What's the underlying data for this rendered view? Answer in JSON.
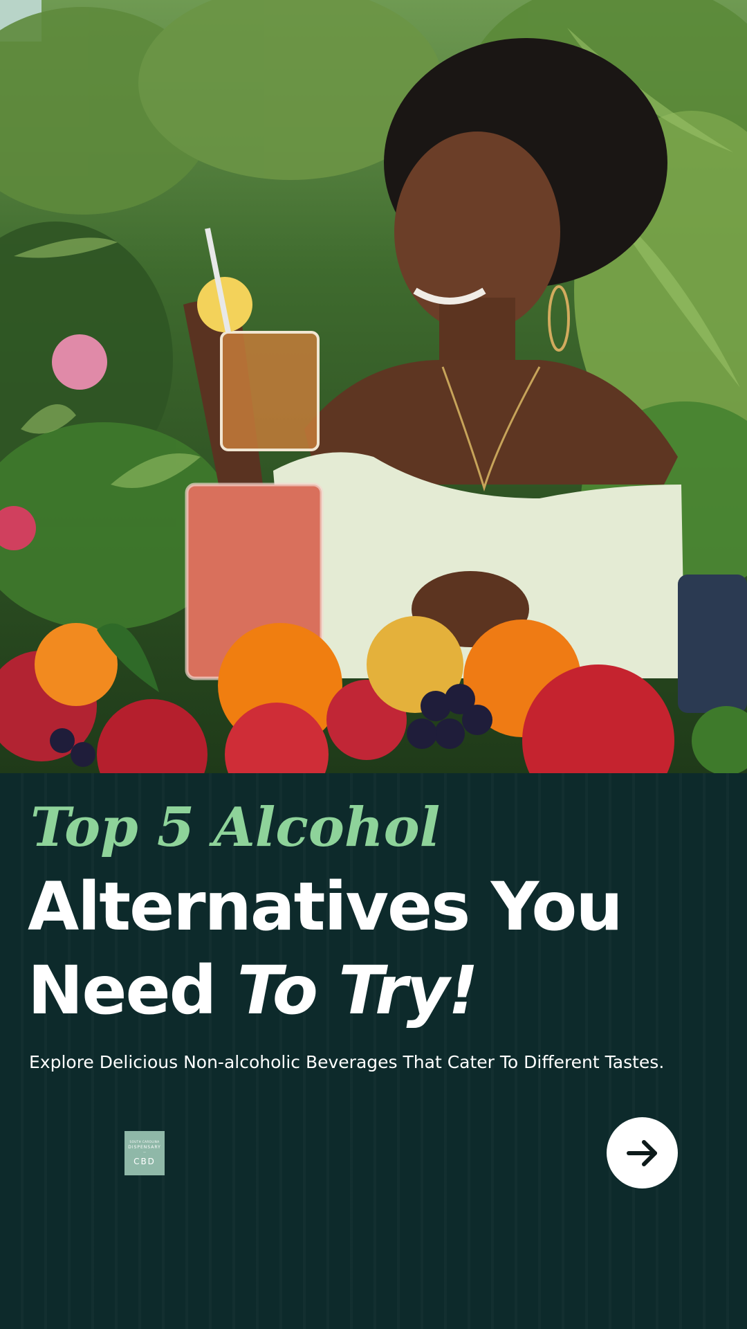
{
  "hero": {
    "icon": "photo-woman-with-drink"
  },
  "headline": {
    "line1": "Top 5 Alcohol",
    "line2": "Alternatives You",
    "line3_plain": "Need ",
    "line3_emphasis": "To Try!"
  },
  "subtitle": "Explore Delicious Non-alcoholic Beverages That Cater To Different Tastes.",
  "brand_logo": {
    "line1": "SOUTH CAROLINA",
    "line2": "DISPENSARY",
    "line3": "—",
    "line4": "CBD"
  },
  "next_button": {
    "icon": "arrow-right-icon"
  },
  "colors": {
    "panel_bg": "#0d2a2b",
    "accent_green": "#8ed39a",
    "text": "#ffffff",
    "logo_bg": "#8fb8a8"
  }
}
